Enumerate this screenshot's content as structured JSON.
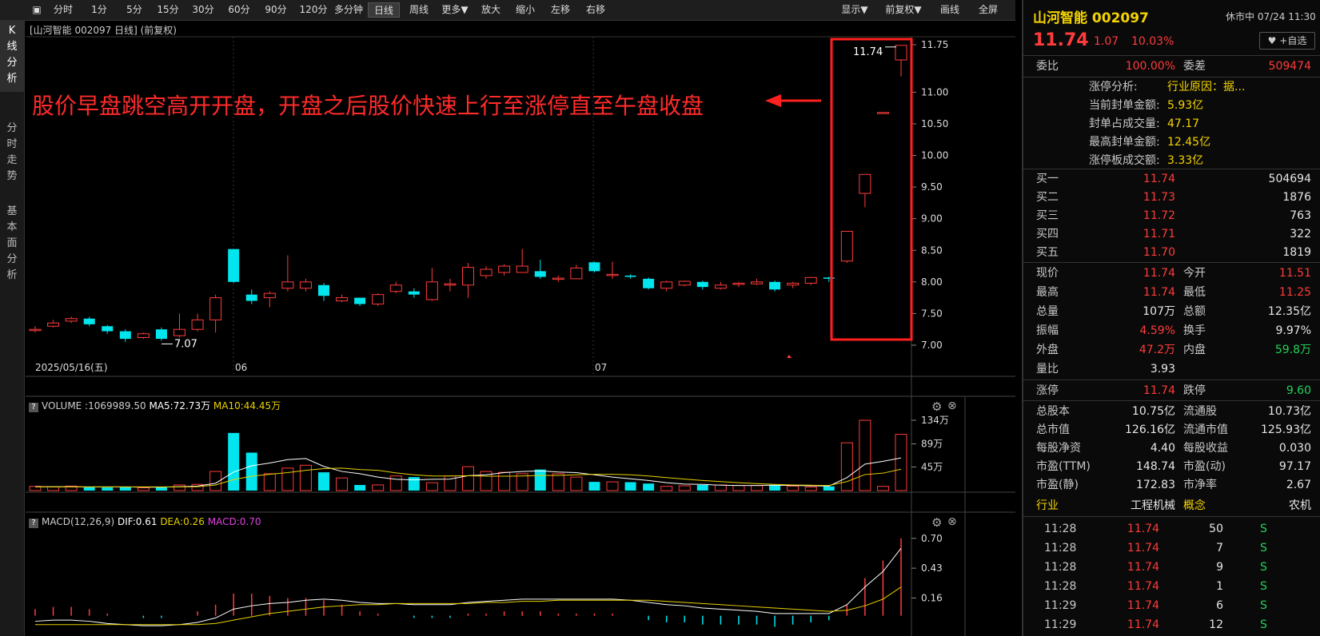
{
  "toolbar": {
    "buttons": [
      "分时",
      "1分",
      "5分",
      "15分",
      "30分",
      "60分",
      "90分",
      "120分",
      "多分钟",
      "日线",
      "周线",
      "更多▼",
      "放大",
      "缩小",
      "左移",
      "右移"
    ],
    "right_buttons": [
      "显示▼",
      "前复权▼",
      "画线",
      "全屏"
    ],
    "active": "日线"
  },
  "sidenav": [
    {
      "label": "K线分析",
      "active": true
    },
    {
      "label": "分时走势",
      "active": false
    },
    {
      "label": "基本面分析",
      "active": false
    }
  ],
  "kline": {
    "title": "[山河智能 002097 日线] (前复权)",
    "annotation": "股价早盘跳空高开开盘，开盘之后股价快速上行至涨停直至午盘收盘",
    "high_label": "11.74",
    "low_label": "7.07",
    "date_labels": [
      "2025/05/16(五)",
      "06",
      "07"
    ],
    "y_ticks": [
      "11.75",
      "11.00",
      "10.50",
      "10.00",
      "9.50",
      "9.00",
      "8.50",
      "8.00",
      "7.50",
      "7.00"
    ]
  },
  "volume": {
    "title_prefix": "VOLUME",
    "value": ":1069989.50",
    "ma5": "MA5:72.73万",
    "ma10": "MA10:44.45万",
    "y_ticks": [
      "134万",
      "89万",
      "45万"
    ]
  },
  "macd": {
    "title": "MACD(12,26,9)",
    "dif": "DIF:0.61",
    "dea": "DEA:0.26",
    "macd": "MACD:0.70",
    "y_ticks": [
      "0.70",
      "0.43",
      "0.16"
    ]
  },
  "chart_data": {
    "type": "candlestick",
    "candles": [
      [
        7.25,
        7.25,
        7.3,
        7.2
      ],
      [
        7.3,
        7.35,
        7.4,
        7.28
      ],
      [
        7.38,
        7.42,
        7.45,
        7.35
      ],
      [
        7.42,
        7.33,
        7.45,
        7.3
      ],
      [
        7.3,
        7.22,
        7.32,
        7.18
      ],
      [
        7.22,
        7.1,
        7.25,
        7.05
      ],
      [
        7.12,
        7.18,
        7.2,
        7.1
      ],
      [
        7.25,
        7.1,
        7.28,
        7.07
      ],
      [
        7.15,
        7.25,
        7.5,
        7.12
      ],
      [
        7.25,
        7.4,
        7.5,
        7.22
      ],
      [
        7.4,
        7.75,
        7.8,
        7.2
      ],
      [
        8.52,
        8.0,
        8.52,
        7.98
      ],
      [
        7.8,
        7.7,
        7.88,
        7.65
      ],
      [
        7.75,
        7.82,
        7.85,
        7.6
      ],
      [
        7.9,
        8.0,
        8.42,
        7.85
      ],
      [
        7.9,
        8.0,
        8.05,
        7.85
      ],
      [
        7.95,
        7.78,
        7.98,
        7.7
      ],
      [
        7.7,
        7.75,
        7.8,
        7.68
      ],
      [
        7.75,
        7.65,
        7.75,
        7.62
      ],
      [
        7.65,
        7.8,
        7.82,
        7.62
      ],
      [
        7.85,
        7.95,
        8.0,
        7.82
      ],
      [
        7.85,
        7.8,
        7.9,
        7.75
      ],
      [
        7.72,
        8.0,
        8.22,
        7.7
      ],
      [
        7.95,
        7.97,
        8.05,
        7.85
      ],
      [
        7.95,
        8.23,
        8.3,
        7.75
      ],
      [
        8.1,
        8.2,
        8.25,
        8.05
      ],
      [
        8.15,
        8.25,
        8.28,
        8.1
      ],
      [
        8.15,
        8.25,
        8.52,
        8.15
      ],
      [
        8.17,
        8.08,
        8.35,
        8.05
      ],
      [
        8.05,
        8.06,
        8.1,
        8.0
      ],
      [
        8.05,
        8.22,
        8.27,
        8.05
      ],
      [
        8.31,
        8.17,
        8.32,
        8.15
      ],
      [
        8.12,
        8.12,
        8.32,
        8.05
      ],
      [
        8.1,
        8.08,
        8.12,
        8.05
      ],
      [
        8.05,
        7.9,
        8.07,
        7.88
      ],
      [
        7.9,
        8.0,
        8.02,
        7.85
      ],
      [
        7.95,
        8.01,
        8.02,
        7.93
      ],
      [
        8.0,
        7.92,
        8.02,
        7.88
      ],
      [
        7.9,
        7.95,
        8.0,
        7.88
      ],
      [
        7.96,
        7.98,
        8.0,
        7.92
      ],
      [
        7.97,
        8.0,
        8.05,
        7.95
      ],
      [
        8.0,
        7.88,
        8.02,
        7.85
      ],
      [
        7.95,
        7.98,
        8.0,
        7.9
      ],
      [
        7.98,
        8.07,
        8.07,
        7.95
      ],
      [
        8.07,
        8.05,
        8.08,
        8.0
      ],
      [
        8.33,
        8.8,
        8.8,
        8.3
      ],
      [
        9.4,
        9.7,
        9.7,
        9.18
      ],
      [
        10.68,
        10.68,
        10.68,
        10.68
      ],
      [
        11.51,
        11.74,
        11.74,
        11.25
      ]
    ],
    "volume": [
      1.5,
      1.3,
      1.6,
      1.2,
      1.1,
      1.3,
      1.0,
      1.2,
      2.0,
      2.2,
      6.8,
      20.5,
      13.5,
      6.0,
      8.0,
      9.0,
      6.5,
      4.5,
      2.0,
      2.0,
      5.2,
      4.8,
      2.8,
      5.2,
      8.5,
      6.8,
      6.5,
      6.0,
      7.5,
      6.0,
      4.8,
      3.1,
      3.1,
      3.0,
      2.5,
      1.5,
      1.7,
      2.0,
      2.0,
      1.8,
      1.8,
      2.0,
      1.6,
      1.3,
      1.5,
      17.0,
      25.0,
      1.5,
      20.0
    ],
    "volume_max": 25.0,
    "ma5_line": [
      1.4,
      1.4,
      1.4,
      1.3,
      1.3,
      1.3,
      1.2,
      1.2,
      1.4,
      1.6,
      2.6,
      6.6,
      8.8,
      9.8,
      11.0,
      11.4,
      8.6,
      6.8,
      6.0,
      4.8,
      4.0,
      3.8,
      4.0,
      4.1,
      5.3,
      5.6,
      6.4,
      6.8,
      7.0,
      6.6,
      6.4,
      5.6,
      4.8,
      4.2,
      3.6,
      2.8,
      2.3,
      2.2,
      1.9,
      1.8,
      1.8,
      1.9,
      1.8,
      1.7,
      1.6,
      4.6,
      9.4,
      10.4,
      11.6
    ],
    "ma10_line": [
      1.3,
      1.3,
      1.3,
      1.3,
      1.3,
      1.3,
      1.3,
      1.3,
      1.3,
      1.4,
      2.0,
      3.9,
      5.1,
      5.8,
      6.4,
      7.2,
      7.8,
      8.0,
      7.5,
      7.2,
      6.3,
      5.6,
      5.2,
      5.2,
      5.3,
      5.1,
      5.1,
      5.2,
      5.4,
      5.4,
      5.6,
      5.8,
      5.8,
      5.6,
      5.2,
      4.6,
      4.1,
      3.6,
      3.2,
      2.8,
      2.5,
      2.2,
      2.0,
      1.9,
      1.8,
      3.2,
      5.7,
      6.2,
      7.6
    ],
    "macd_range": [
      -0.4,
      0.72
    ],
    "dif_line": [
      -0.05,
      -0.04,
      -0.04,
      -0.05,
      -0.07,
      -0.08,
      -0.09,
      -0.09,
      -0.08,
      -0.06,
      -0.02,
      0.06,
      0.09,
      0.11,
      0.12,
      0.14,
      0.15,
      0.14,
      0.12,
      0.11,
      0.11,
      0.1,
      0.1,
      0.1,
      0.12,
      0.13,
      0.14,
      0.15,
      0.15,
      0.15,
      0.15,
      0.15,
      0.15,
      0.14,
      0.12,
      0.1,
      0.09,
      0.07,
      0.06,
      0.05,
      0.04,
      0.02,
      0.02,
      0.02,
      0.02,
      0.1,
      0.26,
      0.4,
      0.61
    ],
    "dea_line": [
      -0.08,
      -0.08,
      -0.08,
      -0.08,
      -0.08,
      -0.08,
      -0.08,
      -0.08,
      -0.08,
      -0.08,
      -0.07,
      -0.04,
      -0.01,
      0.02,
      0.04,
      0.06,
      0.08,
      0.09,
      0.1,
      0.1,
      0.11,
      0.11,
      0.11,
      0.11,
      0.11,
      0.12,
      0.12,
      0.13,
      0.13,
      0.14,
      0.14,
      0.14,
      0.14,
      0.14,
      0.14,
      0.13,
      0.12,
      0.11,
      0.1,
      0.09,
      0.08,
      0.07,
      0.06,
      0.05,
      0.04,
      0.05,
      0.09,
      0.15,
      0.26
    ],
    "macd_hist": [
      0.06,
      0.08,
      0.08,
      0.06,
      0.02,
      0.0,
      -0.02,
      -0.02,
      0.0,
      0.04,
      0.1,
      0.2,
      0.2,
      0.18,
      0.16,
      0.16,
      0.14,
      0.1,
      0.04,
      0.02,
      0.0,
      -0.02,
      -0.02,
      -0.02,
      0.02,
      0.02,
      0.04,
      0.04,
      0.04,
      0.02,
      0.02,
      0.02,
      0.02,
      0.0,
      -0.04,
      -0.06,
      -0.06,
      -0.08,
      -0.08,
      -0.08,
      -0.08,
      -0.1,
      -0.08,
      -0.06,
      -0.04,
      0.1,
      0.34,
      0.5,
      0.7
    ]
  },
  "quote": {
    "name_code": "山河智能 002097",
    "status": "休市中 07/24 11:30",
    "price": "11.74",
    "change": "1.07",
    "change_pct": "10.03%",
    "watch_btn": "+自选",
    "weibi_label": "委比",
    "weibi": "100.00%",
    "weicha_label": "委差",
    "weicha": "509474",
    "limit_analysis": [
      {
        "label": "涨停分析:",
        "value": "行业原因：据..."
      },
      {
        "label": "当前封单金额:",
        "value": "5.93亿"
      },
      {
        "label": "封单占成交量:",
        "value": "47.17"
      },
      {
        "label": "最高封单金额:",
        "value": "12.45亿"
      },
      {
        "label": "涨停板成交额:",
        "value": "3.33亿"
      }
    ],
    "bids": [
      {
        "label": "买一",
        "price": "11.74",
        "vol": "504694"
      },
      {
        "label": "买二",
        "price": "11.73",
        "vol": "1876"
      },
      {
        "label": "买三",
        "price": "11.72",
        "vol": "763"
      },
      {
        "label": "买四",
        "price": "11.71",
        "vol": "322"
      },
      {
        "label": "买五",
        "price": "11.70",
        "vol": "1819"
      }
    ],
    "stats": [
      [
        {
          "l": "现价",
          "v": "11.74",
          "c": "red"
        },
        {
          "l": "今开",
          "v": "11.51",
          "c": "red"
        }
      ],
      [
        {
          "l": "最高",
          "v": "11.74",
          "c": "red"
        },
        {
          "l": "最低",
          "v": "11.25",
          "c": "red"
        }
      ],
      [
        {
          "l": "总量",
          "v": "107万",
          "c": "white"
        },
        {
          "l": "总额",
          "v": "12.35亿",
          "c": "white"
        }
      ],
      [
        {
          "l": "振幅",
          "v": "4.59%",
          "c": "red"
        },
        {
          "l": "换手",
          "v": "9.97%",
          "c": "white"
        }
      ],
      [
        {
          "l": "外盘",
          "v": "47.2万",
          "c": "red"
        },
        {
          "l": "内盘",
          "v": "59.8万",
          "c": "green"
        }
      ],
      [
        {
          "l": "量比",
          "v": "3.93",
          "c": "white"
        }
      ]
    ],
    "limits": [
      {
        "l": "涨停",
        "v": "11.74",
        "c": "red"
      },
      {
        "l": "跌停",
        "v": "9.60",
        "c": "green"
      }
    ],
    "fundamentals": [
      [
        {
          "l": "总股本",
          "v": "10.75亿"
        },
        {
          "l": "流通股",
          "v": "10.73亿"
        }
      ],
      [
        {
          "l": "总市值",
          "v": "126.16亿"
        },
        {
          "l": "流通市值",
          "v": "125.93亿"
        }
      ],
      [
        {
          "l": "每股净资",
          "v": "4.40"
        },
        {
          "l": "每股收益",
          "v": "0.030"
        }
      ],
      [
        {
          "l": "市盈(TTM)",
          "v": "148.74"
        },
        {
          "l": "市盈(动)",
          "v": "97.17"
        }
      ],
      [
        {
          "l": "市盈(静)",
          "v": "172.83"
        },
        {
          "l": "市净率",
          "v": "2.67"
        }
      ]
    ],
    "industry_label": "行业",
    "industry": "工程机械",
    "concept_label": "概念",
    "concept": "农机",
    "ticks": [
      {
        "t": "11:28",
        "p": "11.74",
        "v": "50",
        "s": "S"
      },
      {
        "t": "11:28",
        "p": "11.74",
        "v": "7",
        "s": "S"
      },
      {
        "t": "11:28",
        "p": "11.74",
        "v": "9",
        "s": "S"
      },
      {
        "t": "11:28",
        "p": "11.74",
        "v": "1",
        "s": "S"
      },
      {
        "t": "11:29",
        "p": "11.74",
        "v": "6",
        "s": "S"
      },
      {
        "t": "11:29",
        "p": "11.74",
        "v": "12",
        "s": "S"
      }
    ]
  },
  "colors": {
    "up": "#ff3b3b",
    "down": "#00e5ee",
    "ma5": "#ffffff",
    "ma10": "#e8d100",
    "accent": "#ffd400",
    "box": "#ff2020"
  }
}
